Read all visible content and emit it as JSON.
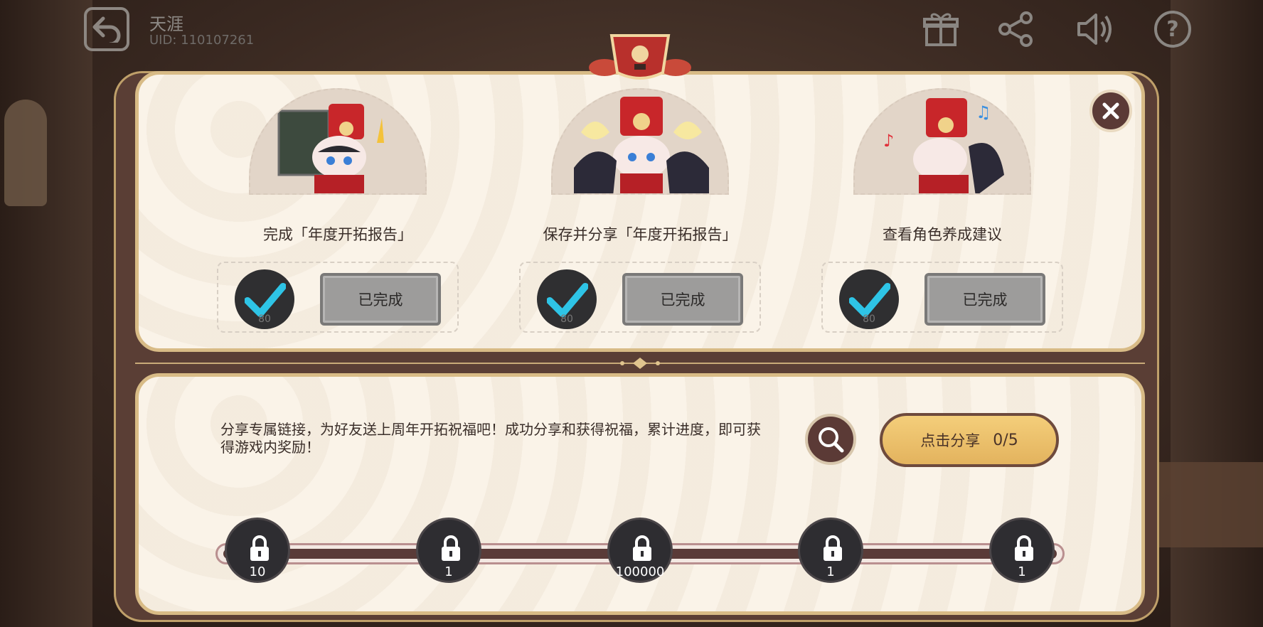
{
  "user": {
    "name": "天涯",
    "uid": "UID: 110107261"
  },
  "tasks": [
    {
      "title": "完成「年度开拓报告」",
      "reward_qty": "80",
      "status": "已完成"
    },
    {
      "title": "保存并分享「年度开拓报告」",
      "reward_qty": "80",
      "status": "已完成"
    },
    {
      "title": "查看角色养成建议",
      "reward_qty": "80",
      "status": "已完成"
    }
  ],
  "share": {
    "description": "分享专属链接，为好友送上周年开拓祝福吧！成功分享和获得祝福，累计进度，即可获得游戏内奖励！",
    "button_label": "点击分享",
    "progress": "0/5"
  },
  "milestones": [
    {
      "value": "10"
    },
    {
      "value": "1"
    },
    {
      "value": "100000"
    },
    {
      "value": "1"
    },
    {
      "value": "1"
    }
  ],
  "icons": {
    "back": "back-arrow-icon",
    "gift": "gift-icon",
    "share": "share-icon",
    "sound": "speaker-icon",
    "help": "help-icon",
    "close": "close-icon",
    "search": "search-icon",
    "lock": "lock-icon",
    "check": "checkmark-icon"
  },
  "colors": {
    "accent": "#e3b35e",
    "check": "#2ec4e6",
    "panel": "#faf3e8",
    "frame": "#5a3e35"
  }
}
